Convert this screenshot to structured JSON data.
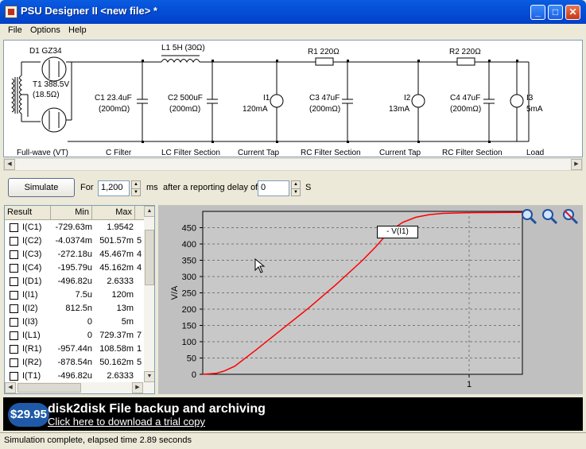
{
  "window": {
    "title": "PSU Designer II  <new file> *",
    "minimize_icon": "minimize-icon",
    "maximize_icon": "maximize-icon",
    "close_icon": "close-icon"
  },
  "menu": [
    "File",
    "Options",
    "Help"
  ],
  "schematic": {
    "components": {
      "d1": "D1 GZ34",
      "t1_a": "T1 388.5V",
      "t1_b": "(18.5Ω)",
      "l1": "L1 5H (30Ω)",
      "r1": "R1 220Ω",
      "r2": "R2 220Ω",
      "c1_a": "C1 23.4uF",
      "c1_b": "(200mΩ)",
      "c2_a": "C2 500uF",
      "c2_b": "(200mΩ)",
      "i1_a": "I1",
      "i1_b": "120mA",
      "c3_a": "C3 47uF",
      "c3_b": "(200mΩ)",
      "i2_a": "I2",
      "i2_b": "13mA",
      "c4_a": "C4 47uF",
      "c4_b": "(200mΩ)",
      "i3_a": "I3",
      "i3_b": "5mA"
    },
    "sections": [
      "Full-wave (VT)",
      "C Filter",
      "LC Filter Section",
      "Current Tap",
      "RC Filter Section",
      "Current Tap",
      "RC Filter Section",
      "Load"
    ]
  },
  "simulation": {
    "button": "Simulate",
    "for_label": "For",
    "duration": "1,200",
    "ms_label": "ms",
    "delay_label": "after a reporting delay of",
    "delay": "0",
    "s_label": "S"
  },
  "results": {
    "headers": [
      "Result",
      "Min",
      "Max"
    ],
    "rows": [
      {
        "name": "I(C1)",
        "min": "-729.63m",
        "max": "1.9542",
        "extra": ""
      },
      {
        "name": "I(C2)",
        "min": "-4.0374m",
        "max": "501.57m",
        "extra": "5"
      },
      {
        "name": "I(C3)",
        "min": "-272.18u",
        "max": "45.467m",
        "extra": "4"
      },
      {
        "name": "I(C4)",
        "min": "-195.79u",
        "max": "45.162m",
        "extra": "4"
      },
      {
        "name": "I(D1)",
        "min": "-496.82u",
        "max": "2.6333",
        "extra": ""
      },
      {
        "name": "I(I1)",
        "min": "7.5u",
        "max": "120m",
        "extra": ""
      },
      {
        "name": "I(I2)",
        "min": "812.5n",
        "max": "13m",
        "extra": ""
      },
      {
        "name": "I(I3)",
        "min": "0",
        "max": "5m",
        "extra": ""
      },
      {
        "name": "I(L1)",
        "min": "0",
        "max": "729.37m",
        "extra": "7"
      },
      {
        "name": "I(R1)",
        "min": "-957.44n",
        "max": "108.58m",
        "extra": "1"
      },
      {
        "name": "I(R2)",
        "min": "-878.54n",
        "max": "50.162m",
        "extra": "5"
      },
      {
        "name": "I(T1)",
        "min": "-496.82u",
        "max": "2.6333",
        "extra": ""
      }
    ]
  },
  "chart_data": {
    "type": "line",
    "ylabel": "V/A",
    "xlabel": "",
    "title": "",
    "ylim": [
      0,
      500
    ],
    "xlim": [
      0,
      1.2
    ],
    "yticks": [
      0,
      50,
      100,
      150,
      200,
      250,
      300,
      350,
      400,
      450
    ],
    "xticks": [
      1
    ],
    "grid": true,
    "legend_position": "top-right",
    "series": [
      {
        "name": "- V(I1)",
        "color": "#ff0000",
        "points": [
          [
            0.0,
            0
          ],
          [
            0.05,
            3
          ],
          [
            0.08,
            10
          ],
          [
            0.12,
            25
          ],
          [
            0.2,
            75
          ],
          [
            0.3,
            140
          ],
          [
            0.4,
            205
          ],
          [
            0.5,
            275
          ],
          [
            0.6,
            350
          ],
          [
            0.65,
            392
          ],
          [
            0.7,
            438
          ],
          [
            0.75,
            466
          ],
          [
            0.8,
            482
          ],
          [
            0.85,
            490
          ],
          [
            0.9,
            494
          ],
          [
            1.0,
            496
          ],
          [
            1.2,
            497
          ]
        ]
      }
    ]
  },
  "banner": {
    "price": "$29.95",
    "headline": "disk2disk File backup and archiving",
    "link": "Click here to download a trial copy"
  },
  "status": "Simulation complete, elapsed time 2.89 seconds"
}
